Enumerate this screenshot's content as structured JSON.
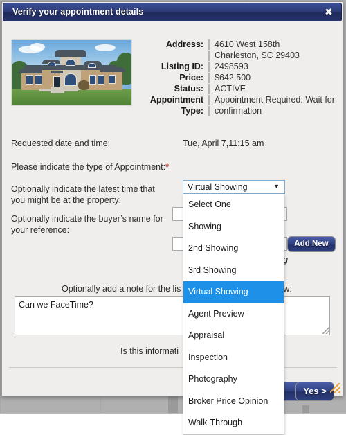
{
  "window": {
    "title": "Verify your appointment details",
    "close_label": "✖"
  },
  "property": {
    "photo_alt": "property-photo",
    "details": [
      {
        "label": "Address:",
        "value": "4610 West 158th"
      },
      {
        "label": "",
        "value": "Charleston, SC 29403"
      },
      {
        "label": "Listing ID:",
        "value": "2498593"
      },
      {
        "label": "Price:",
        "value": "$642,500"
      },
      {
        "label": "Status:",
        "value": "ACTIVE"
      },
      {
        "label": "Appointment",
        "value": "Appointment Required: Wait for"
      },
      {
        "label": "Type:",
        "value": "confirmation"
      }
    ]
  },
  "form": {
    "requested_label": "Requested date and time:",
    "requested_value": "Tue, April 7,11:15 am",
    "type_label": "Please indicate the type of Appointment:",
    "required_mark": "*",
    "latest_time_label_line1": "Optionally indicate the latest time that",
    "latest_time_label_line2": "you might be at the property:",
    "latest_time_value": "",
    "buyer_label_line1": "Optionally indicate the buyer’s name for",
    "buyer_label_line2": "your reference:",
    "buyer_value": "",
    "add_new_label": "Add New",
    "share_note": "e with listing",
    "note_label": "Optionally add a note for the lis",
    "note_label_tail": "w:",
    "note_value": "Can we FaceTime?",
    "confirm_question": "Is this informati"
  },
  "select": {
    "value": "Virtual Showing",
    "arrow": "▼",
    "options": [
      "Select One",
      "Showing",
      "2nd Showing",
      "3rd Showing",
      "Virtual Showing",
      "Agent Preview",
      "Appraisal",
      "Inspection",
      "Photography",
      "Broker Price Opinion",
      "Walk-Through"
    ],
    "selected_index": 4
  },
  "actions": {
    "no_label": "",
    "yes_label": "Yes >"
  },
  "colors": {
    "titlebar": "#2d3c79",
    "highlight": "#1e90e8",
    "button": "#2e3f80",
    "required": "#c0392b",
    "grip": "#e8a33d"
  }
}
